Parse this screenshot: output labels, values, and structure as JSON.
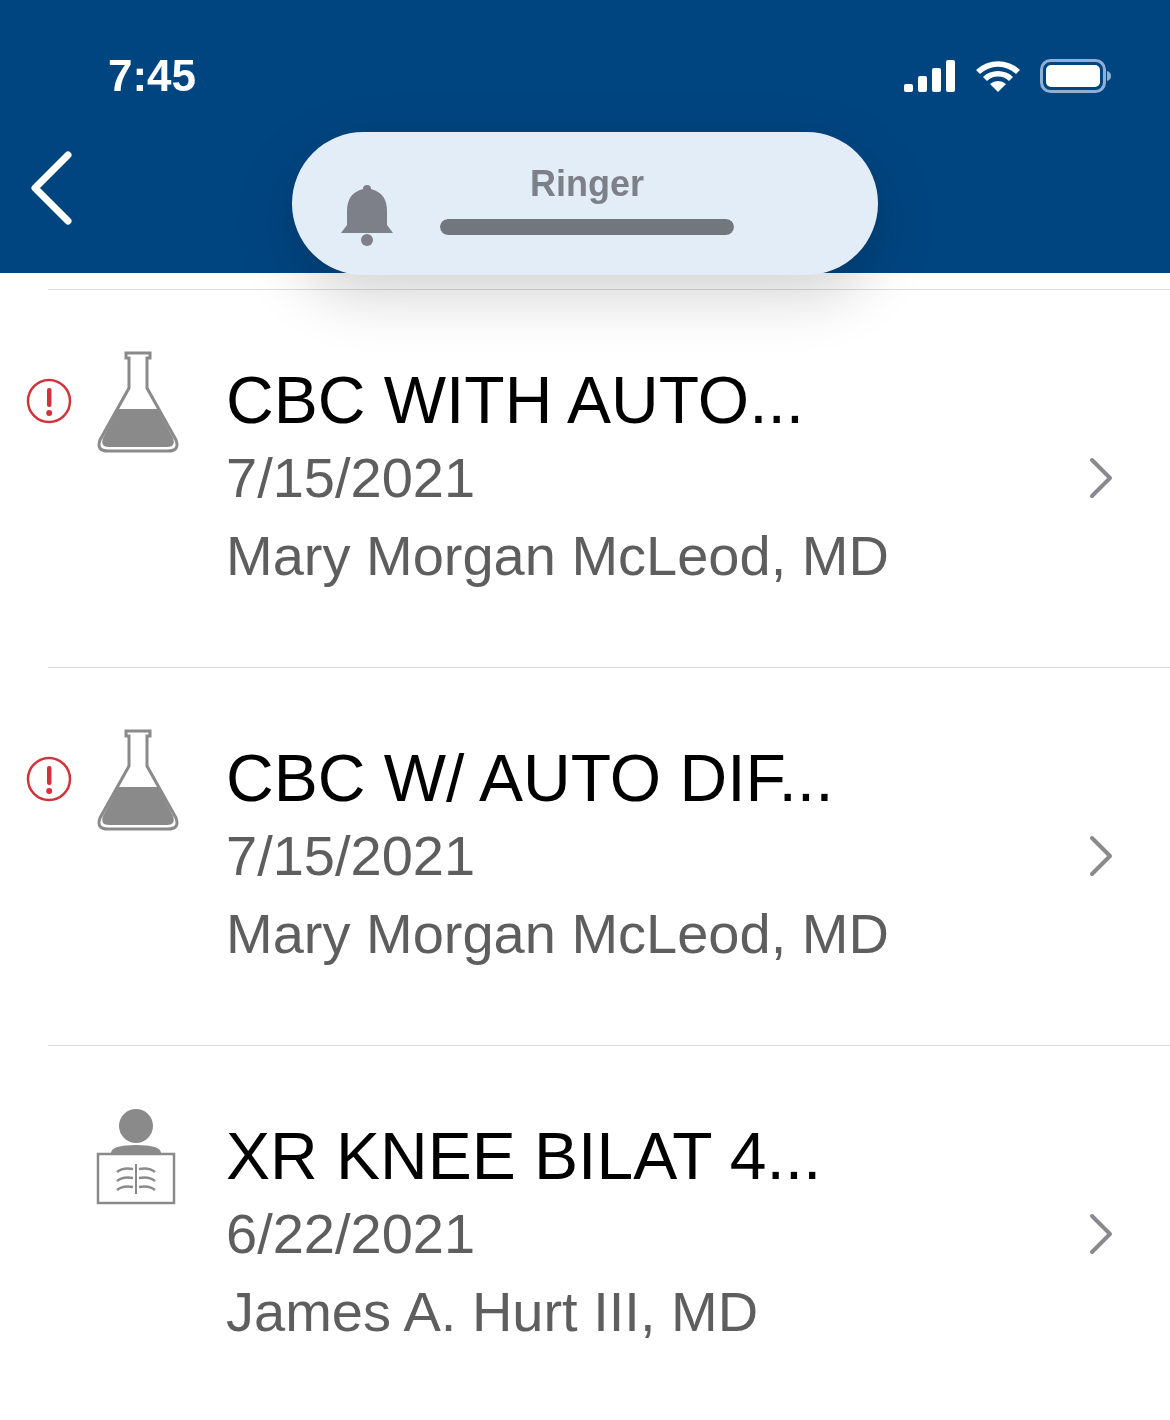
{
  "status_bar": {
    "time": "7:45"
  },
  "ringer": {
    "label": "Ringer",
    "level": 1
  },
  "results": [
    {
      "kind": "lab",
      "alert": true,
      "title": "CBC WITH AUTO...",
      "date": "7/15/2021",
      "provider": "Mary Morgan McLeod, MD"
    },
    {
      "kind": "lab",
      "alert": true,
      "title": "CBC W/ AUTO DIF...",
      "date": "7/15/2021",
      "provider": "Mary Morgan McLeod, MD"
    },
    {
      "kind": "imaging",
      "alert": false,
      "title": "XR KNEE BILAT 4...",
      "date": "6/22/2021",
      "provider": "James A. Hurt III, MD"
    }
  ]
}
